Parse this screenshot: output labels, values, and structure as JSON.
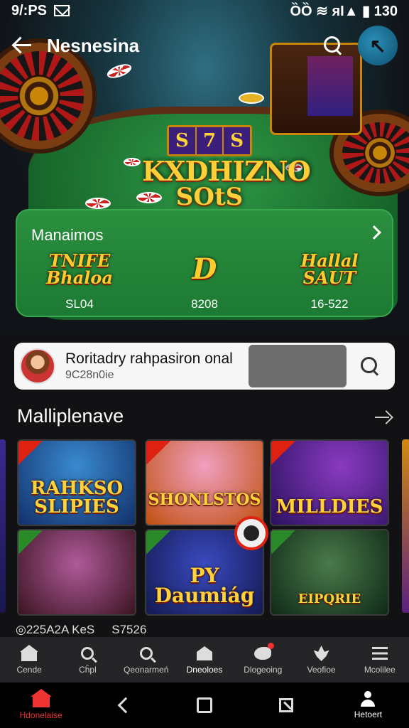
{
  "status_bar": {
    "time": "9/:PS",
    "right_text": "ȌȌ ≋ ᴙI▲ ▮ 130",
    "icons": [
      "mail-icon",
      "vibrate-icon",
      "wifi-icon",
      "signal-icon",
      "battery-icon"
    ]
  },
  "app_bar": {
    "title": "Nesnesina",
    "avatar_glyph": "↖",
    "icons": [
      "back-arrow-icon",
      "search-icon",
      "profile-avatar"
    ]
  },
  "hero": {
    "logo_reels": [
      "S",
      "7",
      "S"
    ],
    "logo_title": "KXDHIZNO",
    "logo_sub": "SOtS"
  },
  "featured": {
    "header": "Manaimos",
    "items": [
      {
        "logo": "TNIFE Bhaloa",
        "value": "SL04"
      },
      {
        "logo": "D",
        "value": "8208"
      },
      {
        "logo": "Hallal SAUT",
        "value": "16-522"
      }
    ]
  },
  "search_strip": {
    "title": "Roritadry rahpasiron onal",
    "subtitle": "9C28n0ie"
  },
  "section": {
    "title": "Malliplenave"
  },
  "games": [
    {
      "label": "RAHKSO SLIPIES"
    },
    {
      "label": "SHONLSTOS"
    },
    {
      "label": "MILLDIES"
    },
    {
      "label": ""
    },
    {
      "label": "PY Daumiág"
    },
    {
      "label": "EIPQRIE"
    }
  ],
  "meta": {
    "left": "◎225A2A KeS",
    "right": "S7526"
  },
  "bottom_nav": [
    {
      "label": "Cende",
      "icon": "home-icon"
    },
    {
      "label": "Cĥpl",
      "icon": "search-icon"
    },
    {
      "label": "Qeonarmeń",
      "icon": "search-person-icon"
    },
    {
      "label": "Dneoloes",
      "icon": "house-icon"
    },
    {
      "label": "Dlogeoing",
      "icon": "bird-icon"
    },
    {
      "label": "Veofioe",
      "icon": "leaf-icon"
    },
    {
      "label": "Mcolilee",
      "icon": "menu-icon"
    }
  ],
  "system_nav": {
    "home_label": "Hdonelaise",
    "profile_label": "Hetoert"
  },
  "colors": {
    "accent_red": "#dd2211",
    "felt_green": "#1d7a33",
    "gold": "#ffcf3a",
    "background": "#121214"
  }
}
